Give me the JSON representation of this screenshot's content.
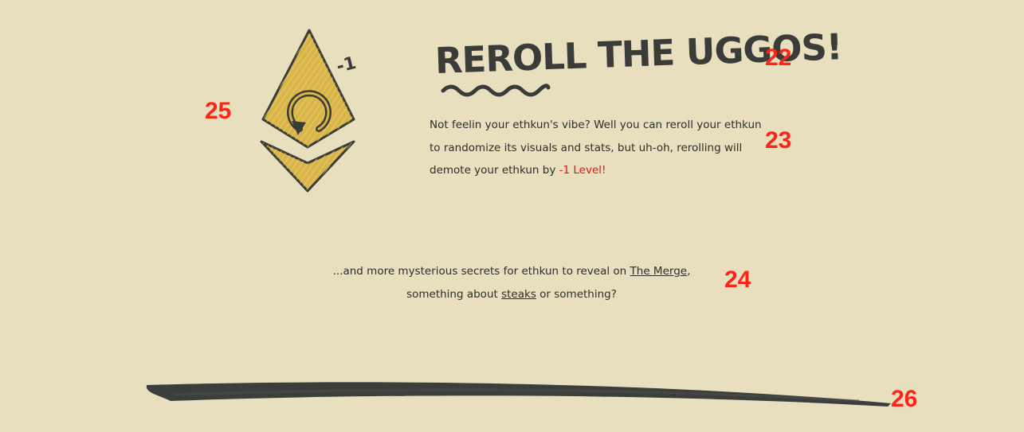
{
  "section": {
    "title": "REROLL THE UGGOS!",
    "level_badge": "-1",
    "description_before": "Not feelin your ethkun's vibe? Well you can reroll your ethkun to randomize its visuals and stats, but uh-oh, rerolling will demote your ethkun by ",
    "description_highlight": "-1 Level!"
  },
  "secrets": {
    "text_before": "...and more mysterious secrets for ethkun to reveal on ",
    "link_merge": "The Merge",
    "text_middle": ", something about ",
    "link_steaks": "steaks",
    "text_after": " or something?"
  },
  "markers": {
    "m22": "22",
    "m23": "23",
    "m24": "24",
    "m25": "25",
    "m26": "26"
  },
  "colors": {
    "background": "#e7dfbe",
    "text": "#2c2e2c",
    "highlight": "#e2141a",
    "eth_gold": "#d9b547",
    "ink": "#3a3c3a",
    "marker": "#ff2418"
  },
  "icons": {
    "illustration": "eth-diamond-reroll-icon",
    "divider": "brush-stroke-divider"
  }
}
